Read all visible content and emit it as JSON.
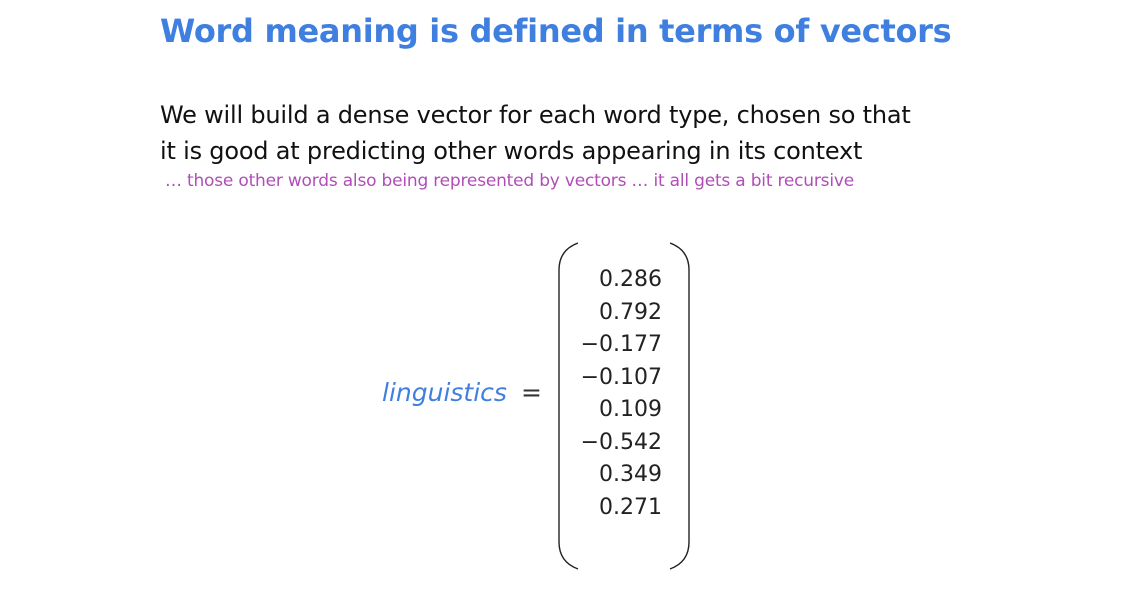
{
  "slide": {
    "title": "Word meaning is defined in terms of vectors",
    "body_lines": [
      "We will build a dense vector for each word type, chosen so that",
      "it is good at predicting other words appearing in its context"
    ],
    "aside": "… those other words also being represented by vectors … it all gets a bit recursive"
  },
  "equation": {
    "word": "linguistics",
    "equals": "=",
    "vector": [
      "0.286",
      "0.792",
      "−0.177",
      "−0.107",
      "0.109",
      "−0.542",
      "0.349",
      "0.271"
    ]
  },
  "colors": {
    "title": "#3f7fe0",
    "aside": "#b04db8",
    "word": "#3f7fe0"
  }
}
